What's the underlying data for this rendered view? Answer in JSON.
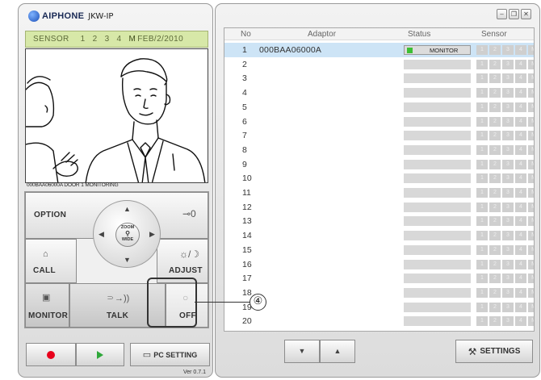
{
  "brand": {
    "logo": "AIPHONE",
    "model": "JKW-IP"
  },
  "sensor_bar": {
    "label": "SENSOR",
    "numbers": [
      "1",
      "2",
      "3",
      "4"
    ],
    "active": "M",
    "date": "FEB/2/2010"
  },
  "camera": {
    "caption": "000BAA06000A DOOR 1 MONITORING"
  },
  "controls": {
    "option": "OPTION",
    "key_icon": "⊸0",
    "zoom_top": "ZOOM",
    "zoom_bottom": "WIDE",
    "call": "CALL",
    "adjust": "ADJUST",
    "adjust_icon": "☼/☽",
    "monitor": "MONITOR",
    "talk": "TALK",
    "talk_icon": "⸧→))",
    "off": "OFF",
    "off_icon": "○"
  },
  "bottom_left": {
    "pc_setting": "PC SETTING"
  },
  "version": "Ver 0.7.1",
  "list": {
    "headers": {
      "no": "No",
      "adaptor": "Adaptor",
      "status": "Status",
      "sensor": "Sensor"
    },
    "sensor_labels": [
      "1",
      "2",
      "3",
      "4",
      "M"
    ],
    "rows": [
      {
        "no": "1",
        "adaptor": "000BAA06000A",
        "status": "MONITOR"
      },
      {
        "no": "2",
        "adaptor": "",
        "status": ""
      },
      {
        "no": "3",
        "adaptor": "",
        "status": ""
      },
      {
        "no": "4",
        "adaptor": "",
        "status": ""
      },
      {
        "no": "5",
        "adaptor": "",
        "status": ""
      },
      {
        "no": "6",
        "adaptor": "",
        "status": ""
      },
      {
        "no": "7",
        "adaptor": "",
        "status": ""
      },
      {
        "no": "8",
        "adaptor": "",
        "status": ""
      },
      {
        "no": "9",
        "adaptor": "",
        "status": ""
      },
      {
        "no": "10",
        "adaptor": "",
        "status": ""
      },
      {
        "no": "11",
        "adaptor": "",
        "status": ""
      },
      {
        "no": "12",
        "adaptor": "",
        "status": ""
      },
      {
        "no": "13",
        "adaptor": "",
        "status": ""
      },
      {
        "no": "14",
        "adaptor": "",
        "status": ""
      },
      {
        "no": "15",
        "adaptor": "",
        "status": ""
      },
      {
        "no": "16",
        "adaptor": "",
        "status": ""
      },
      {
        "no": "17",
        "adaptor": "",
        "status": ""
      },
      {
        "no": "18",
        "adaptor": "",
        "status": ""
      },
      {
        "no": "19",
        "adaptor": "",
        "status": ""
      },
      {
        "no": "20",
        "adaptor": "",
        "status": ""
      }
    ]
  },
  "callout": "④",
  "bottom_right": {
    "down": "▼",
    "up": "▲",
    "settings": "SETTINGS"
  },
  "colors": {
    "sensor_bar": "#d7e8a8",
    "selected_row": "#cde4f6",
    "led": "#3cbf34",
    "record": "#e8001c",
    "play": "#2fa83a"
  }
}
